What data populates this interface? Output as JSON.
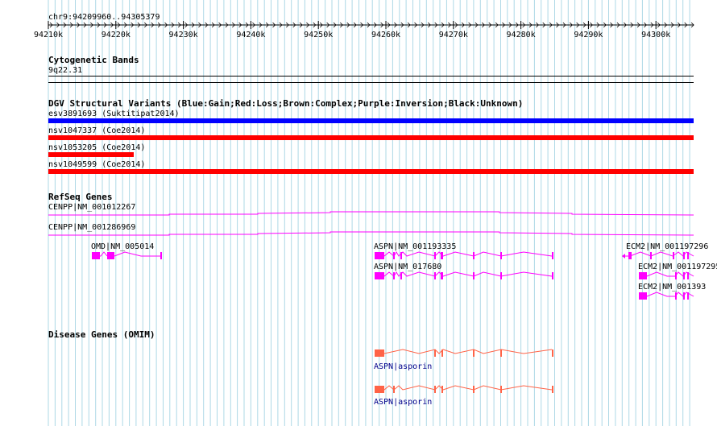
{
  "ruler": {
    "position": "chr9:94209960..94305379",
    "ticks": [
      "94210k",
      "94220k",
      "94230k",
      "94240k",
      "94250k",
      "94260k",
      "94270k",
      "94280k",
      "94290k",
      "94300k"
    ]
  },
  "tracks": {
    "cytoband": {
      "title": "Cytogenetic Bands",
      "band": "9q22.31"
    },
    "dgv": {
      "title": "DGV Structural Variants (Blue:Gain;Red:Loss;Brown:Complex;Purple:Inversion;Black:Unknown)",
      "variants": [
        {
          "label": "esv3891693 (Suktitipat2014)",
          "color": "#0000ff"
        },
        {
          "label": "nsv1047337 (Coe2014)",
          "color": "#ff0000"
        },
        {
          "label": "nsv1053205 (Coe2014)",
          "color": "#ff0000"
        },
        {
          "label": "nsv1049599 (Coe2014)",
          "color": "#ff0000"
        }
      ]
    },
    "refseq": {
      "title": "RefSeq Genes",
      "genes": [
        "CENPP|NM_001012267",
        "CENPP|NM_001286969",
        "OMD|NM_005014",
        "ASPN|NM_001193335",
        "ASPN|NM_017680",
        "ECM2|NM_001197296",
        "ECM2|NM_001197295",
        "ECM2|NM_001393"
      ],
      "color": "#ff00ff"
    },
    "omim": {
      "title": "Disease Genes (OMIM)",
      "genes": [
        "ASPN|asporin",
        "ASPN|asporin"
      ],
      "color": "#ff6347",
      "label_color": "#00008b"
    }
  },
  "colors": {
    "grid": "#add8e6",
    "text": "#000000"
  }
}
